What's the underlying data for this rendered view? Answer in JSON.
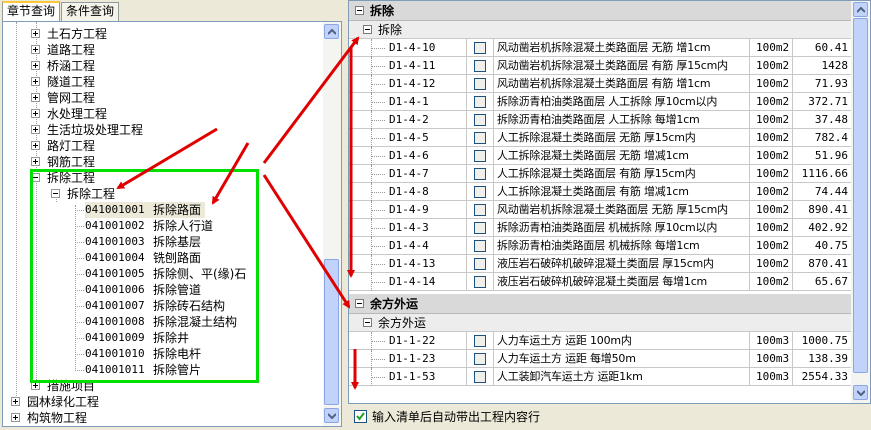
{
  "left_panel": {
    "tabs": [
      {
        "label": "章节查询",
        "active": true
      },
      {
        "label": "条件查询",
        "active": false
      }
    ],
    "tree": {
      "top_items": [
        "土石方工程",
        "道路工程",
        "桥涵工程",
        "隧道工程",
        "管网工程",
        "水处理工程",
        "生活垃圾处理工程",
        "路灯工程",
        "钢筋工程"
      ],
      "expanded_item": "拆除工程",
      "sub_item": "拆除工程",
      "leaves": [
        {
          "code": "041001001",
          "name": "拆除路面"
        },
        {
          "code": "041001002",
          "name": "拆除人行道"
        },
        {
          "code": "041001003",
          "name": "拆除基层"
        },
        {
          "code": "041001004",
          "name": "铣刨路面"
        },
        {
          "code": "041001005",
          "name": "拆除侧、平(缘)石"
        },
        {
          "code": "041001006",
          "name": "拆除管道"
        },
        {
          "code": "041001007",
          "name": "拆除砖石结构"
        },
        {
          "code": "041001008",
          "name": "拆除混凝土结构"
        },
        {
          "code": "041001009",
          "name": "拆除井"
        },
        {
          "code": "041001010",
          "name": "拆除电杆"
        },
        {
          "code": "041001011",
          "name": "拆除管片"
        }
      ],
      "after_item": "措施项目",
      "root_items": [
        "园林绿化工程",
        "构筑物工程"
      ]
    }
  },
  "right_panel": {
    "groups": [
      {
        "title": "拆除",
        "subtitle": "拆除",
        "rows": [
          {
            "code": "D1-4-10",
            "name": "风动凿岩机拆除混凝土类路面层 无筋 增1cm",
            "unit": "100m2",
            "qty": "60.41"
          },
          {
            "code": "D1-4-11",
            "name": "风动凿岩机拆除混凝土类路面层 有筋 厚15cm内",
            "unit": "100m2",
            "qty": "1428"
          },
          {
            "code": "D1-4-12",
            "name": "风动凿岩机拆除混凝土类路面层 有筋 增1cm",
            "unit": "100m2",
            "qty": "71.93"
          },
          {
            "code": "D1-4-1",
            "name": "拆除沥青柏油类路面层 人工拆除 厚10cm以内",
            "unit": "100m2",
            "qty": "372.71"
          },
          {
            "code": "D1-4-2",
            "name": "拆除沥青柏油类路面层 人工拆除 每增1cm",
            "unit": "100m2",
            "qty": "37.48"
          },
          {
            "code": "D1-4-5",
            "name": "人工拆除混凝土类路面层 无筋 厚15cm内",
            "unit": "100m2",
            "qty": "782.4"
          },
          {
            "code": "D1-4-6",
            "name": "人工拆除混凝土类路面层 无筋 增减1cm",
            "unit": "100m2",
            "qty": "51.96"
          },
          {
            "code": "D1-4-7",
            "name": "人工拆除混凝土类路面层 有筋 厚15cm内",
            "unit": "100m2",
            "qty": "1116.66"
          },
          {
            "code": "D1-4-8",
            "name": "人工拆除混凝土类路面层 有筋 增减1cm",
            "unit": "100m2",
            "qty": "74.44"
          },
          {
            "code": "D1-4-9",
            "name": "风动凿岩机拆除混凝土类路面层 无筋 厚15cm内",
            "unit": "100m2",
            "qty": "890.41"
          },
          {
            "code": "D1-4-3",
            "name": "拆除沥青柏油类路面层 机械拆除 厚10cm以内",
            "unit": "100m2",
            "qty": "402.92"
          },
          {
            "code": "D1-4-4",
            "name": "拆除沥青柏油类路面层 机械拆除 每增1cm",
            "unit": "100m2",
            "qty": "40.75"
          },
          {
            "code": "D1-4-13",
            "name": "液压岩石破碎机破碎混凝土类面层 厚15cm内",
            "unit": "100m2",
            "qty": "870.41"
          },
          {
            "code": "D1-4-14",
            "name": "液压岩石破碎机破碎混凝土类面层 每增1cm",
            "unit": "100m2",
            "qty": "65.67"
          }
        ]
      },
      {
        "title": "余方外运",
        "subtitle": "余方外运",
        "rows": [
          {
            "code": "D1-1-22",
            "name": "人力车运土方 运距 100m内",
            "unit": "100m3",
            "qty": "1000.75"
          },
          {
            "code": "D1-1-23",
            "name": "人力车运土方 运距 每增50m",
            "unit": "100m3",
            "qty": "138.39"
          },
          {
            "code": "D1-1-53",
            "name": "人工装卸汽车运土方 运距1km",
            "unit": "100m3",
            "qty": "2554.33"
          }
        ]
      }
    ],
    "footer": {
      "checkbox_label": "输入清单后自动带出工程内容行",
      "checked": true
    }
  },
  "colors": {
    "highlight_box": "#00E000",
    "arrows": "#E00000",
    "window_bg": "#ECE9D8"
  }
}
